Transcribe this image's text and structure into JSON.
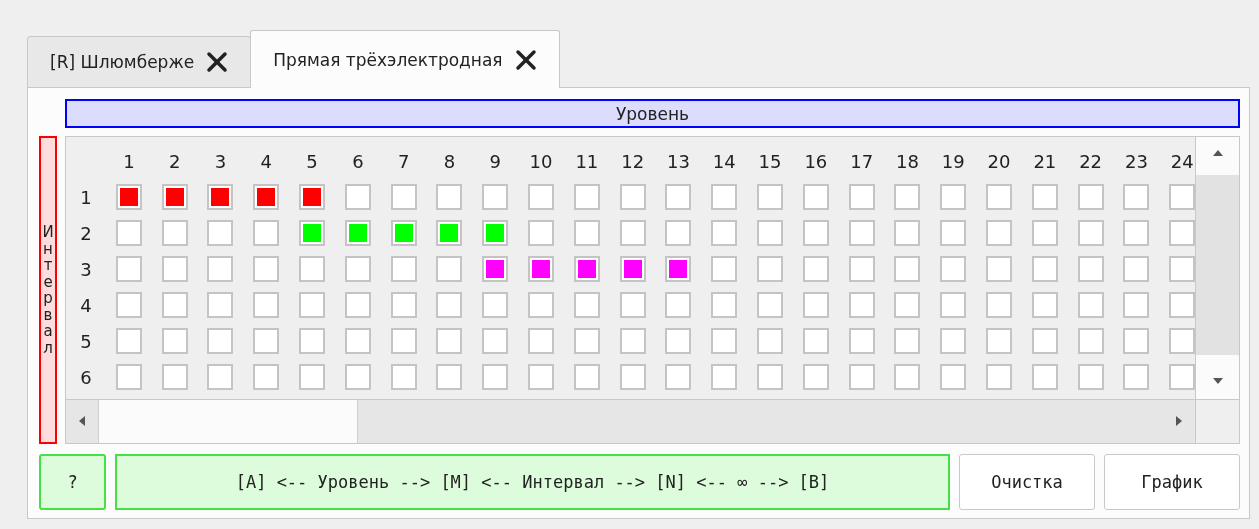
{
  "tabs": [
    {
      "label": "[R] Шлюмберже",
      "selected": false
    },
    {
      "label": "Прямая трёхэлектродная",
      "selected": true
    }
  ],
  "level_header": "Уровень",
  "interval_label": "Интервал",
  "grid": {
    "columns": [
      "1",
      "2",
      "3",
      "4",
      "5",
      "6",
      "7",
      "8",
      "9",
      "10",
      "11",
      "12",
      "13",
      "14",
      "15",
      "16",
      "17",
      "18",
      "19",
      "20",
      "21",
      "22",
      "23",
      "24"
    ],
    "rows": [
      {
        "label": "1",
        "cells": [
          {
            "on": true,
            "color": "#ff0000"
          },
          {
            "on": true,
            "color": "#ff0000"
          },
          {
            "on": true,
            "color": "#ff0000"
          },
          {
            "on": true,
            "color": "#ff0000"
          },
          {
            "on": true,
            "color": "#ff0000"
          },
          {
            "on": false
          },
          {
            "on": false
          },
          {
            "on": false
          },
          {
            "on": false
          },
          {
            "on": false
          },
          {
            "on": false
          },
          {
            "on": false
          },
          {
            "on": false
          },
          {
            "on": false
          },
          {
            "on": false
          },
          {
            "on": false
          },
          {
            "on": false
          },
          {
            "on": false
          },
          {
            "on": false
          },
          {
            "on": false
          },
          {
            "on": false
          },
          {
            "on": false
          },
          {
            "on": false
          },
          {
            "on": false
          }
        ]
      },
      {
        "label": "2",
        "cells": [
          {
            "on": false
          },
          {
            "on": false
          },
          {
            "on": false
          },
          {
            "on": false
          },
          {
            "on": true,
            "color": "#00ff00"
          },
          {
            "on": true,
            "color": "#00ff00"
          },
          {
            "on": true,
            "color": "#00ff00"
          },
          {
            "on": true,
            "color": "#00ff00"
          },
          {
            "on": true,
            "color": "#00ff00"
          },
          {
            "on": false
          },
          {
            "on": false
          },
          {
            "on": false
          },
          {
            "on": false
          },
          {
            "on": false
          },
          {
            "on": false
          },
          {
            "on": false
          },
          {
            "on": false
          },
          {
            "on": false
          },
          {
            "on": false
          },
          {
            "on": false
          },
          {
            "on": false
          },
          {
            "on": false
          },
          {
            "on": false
          },
          {
            "on": false
          }
        ]
      },
      {
        "label": "3",
        "cells": [
          {
            "on": false
          },
          {
            "on": false
          },
          {
            "on": false
          },
          {
            "on": false
          },
          {
            "on": false
          },
          {
            "on": false
          },
          {
            "on": false
          },
          {
            "on": false
          },
          {
            "on": true,
            "color": "#ff00ff"
          },
          {
            "on": true,
            "color": "#ff00ff"
          },
          {
            "on": true,
            "color": "#ff00ff"
          },
          {
            "on": true,
            "color": "#ff00ff"
          },
          {
            "on": true,
            "color": "#ff00ff"
          },
          {
            "on": false
          },
          {
            "on": false
          },
          {
            "on": false
          },
          {
            "on": false
          },
          {
            "on": false
          },
          {
            "on": false
          },
          {
            "on": false
          },
          {
            "on": false
          },
          {
            "on": false
          },
          {
            "on": false
          },
          {
            "on": false
          }
        ]
      },
      {
        "label": "4",
        "cells": [
          {
            "on": false
          },
          {
            "on": false
          },
          {
            "on": false
          },
          {
            "on": false
          },
          {
            "on": false
          },
          {
            "on": false
          },
          {
            "on": false
          },
          {
            "on": false
          },
          {
            "on": false
          },
          {
            "on": false
          },
          {
            "on": false
          },
          {
            "on": false
          },
          {
            "on": false
          },
          {
            "on": false
          },
          {
            "on": false
          },
          {
            "on": false
          },
          {
            "on": false
          },
          {
            "on": false
          },
          {
            "on": false
          },
          {
            "on": false
          },
          {
            "on": false
          },
          {
            "on": false
          },
          {
            "on": false
          },
          {
            "on": false
          }
        ]
      },
      {
        "label": "5",
        "cells": [
          {
            "on": false
          },
          {
            "on": false
          },
          {
            "on": false
          },
          {
            "on": false
          },
          {
            "on": false
          },
          {
            "on": false
          },
          {
            "on": false
          },
          {
            "on": false
          },
          {
            "on": false
          },
          {
            "on": false
          },
          {
            "on": false
          },
          {
            "on": false
          },
          {
            "on": false
          },
          {
            "on": false
          },
          {
            "on": false
          },
          {
            "on": false
          },
          {
            "on": false
          },
          {
            "on": false
          },
          {
            "on": false
          },
          {
            "on": false
          },
          {
            "on": false
          },
          {
            "on": false
          },
          {
            "on": false
          },
          {
            "on": false
          }
        ]
      },
      {
        "label": "6",
        "cells": [
          {
            "on": false
          },
          {
            "on": false
          },
          {
            "on": false
          },
          {
            "on": false
          },
          {
            "on": false
          },
          {
            "on": false
          },
          {
            "on": false
          },
          {
            "on": false
          },
          {
            "on": false
          },
          {
            "on": false
          },
          {
            "on": false
          },
          {
            "on": false
          },
          {
            "on": false
          },
          {
            "on": false
          },
          {
            "on": false
          },
          {
            "on": false
          },
          {
            "on": false
          },
          {
            "on": false
          },
          {
            "on": false
          },
          {
            "on": false
          },
          {
            "on": false
          },
          {
            "on": false
          },
          {
            "on": false
          },
          {
            "on": false
          }
        ]
      }
    ]
  },
  "help_button": "?",
  "legend": "[A] <-- Уровень --> [M] <-- Интервал --> [N] <-- ∞ --> [B]",
  "buttons": [
    "Очистка",
    "График"
  ]
}
